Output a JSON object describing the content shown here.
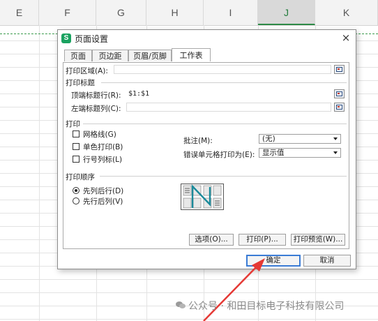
{
  "spreadsheet": {
    "columns": [
      "E",
      "F",
      "G",
      "H",
      "I",
      "J",
      "K"
    ],
    "selected_column": "J"
  },
  "dialog": {
    "title": "页面设置",
    "app_icon_letter": "S",
    "close_glyph": "×",
    "tabs": [
      "页面",
      "页边距",
      "页眉/页脚",
      "工作表"
    ],
    "active_tab": "工作表",
    "print_area": {
      "label": "打印区域(A):",
      "value": ""
    },
    "print_titles": {
      "section": "打印标题",
      "top_rows": {
        "label": "顶端标题行(R):",
        "value": "$1:$1"
      },
      "left_cols": {
        "label": "左端标题列(C):",
        "value": ""
      }
    },
    "print": {
      "section": "打印",
      "gridlines": {
        "label": "网格线(G)",
        "checked": false
      },
      "black_white": {
        "label": "单色打印(B)",
        "checked": false
      },
      "row_col_headings": {
        "label": "行号列标(L)",
        "checked": false
      },
      "comments": {
        "label": "批注(M):",
        "value": "(无)"
      },
      "cell_errors": {
        "label": "错误单元格打印为(E):",
        "value": "显示值"
      }
    },
    "page_order": {
      "section": "打印顺序",
      "down_then_over": {
        "label": "先列后行(D)",
        "selected": true
      },
      "over_then_down": {
        "label": "先行后列(V)",
        "selected": false
      }
    },
    "buttons": {
      "options": "选项(O)...",
      "print": "打印(P)...",
      "preview": "打印预览(W)...",
      "ok": "确定",
      "cancel": "取消"
    }
  },
  "watermark": "公众号 · 和田目标电子科技有限公司",
  "colors": {
    "accent_green": "#2e8b47",
    "arrow_red": "#e53935",
    "focus_blue": "#3a7bd5"
  }
}
